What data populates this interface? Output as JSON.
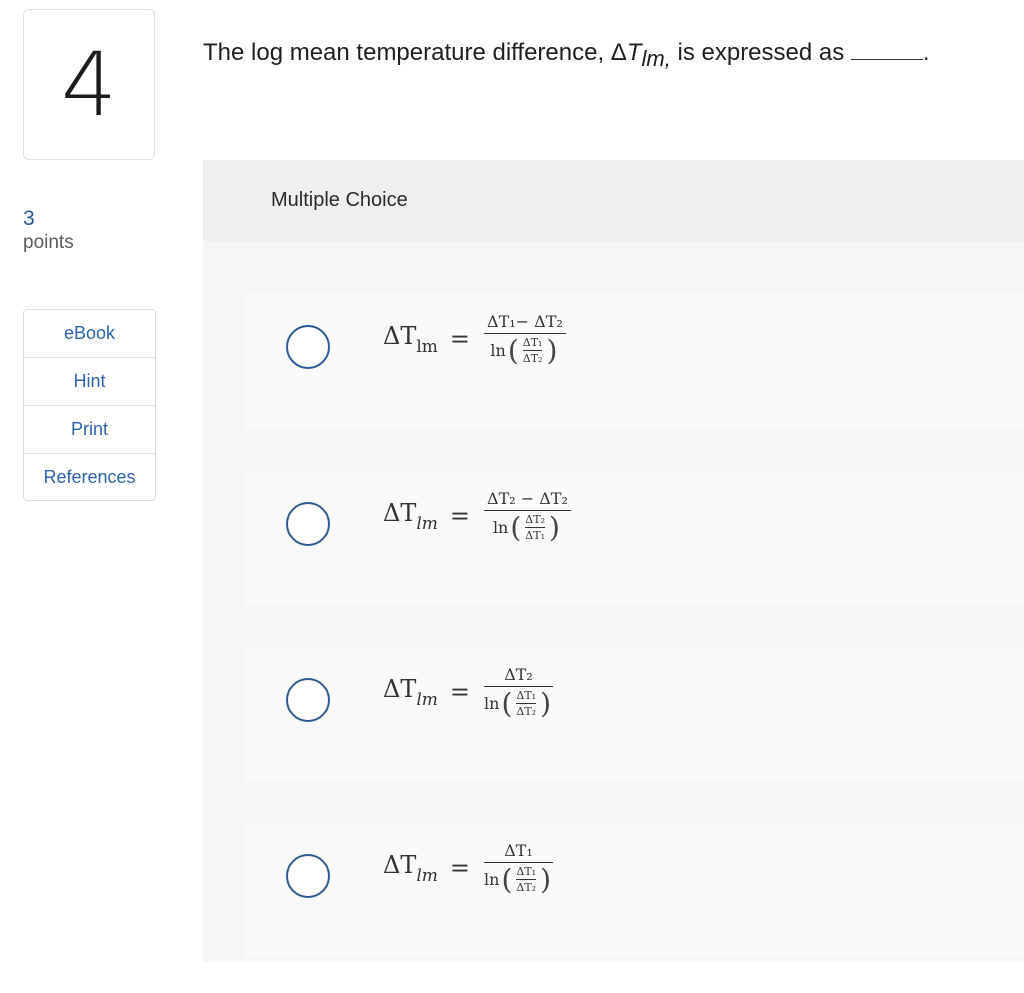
{
  "question_number": "4",
  "points": {
    "value": "3",
    "label": "points"
  },
  "tools": [
    "eBook",
    "Hint",
    "Print",
    "References"
  ],
  "question": {
    "before": "The log mean temperature difference, Δ",
    "var": "T",
    "sub": "lm,",
    "after": " is expressed as ",
    "end": "."
  },
  "section_label": "Multiple Choice",
  "options": [
    {
      "lhs_sub": "lm",
      "numerator": "ΔT₁− ΔT₂",
      "small_num": "ΔT₁",
      "small_den": "ΔT₂"
    },
    {
      "lhs_sub": "lm",
      "numerator": "ΔT₂ − ΔT₂",
      "small_num": "ΔT₂",
      "small_den": "ΔT₁"
    },
    {
      "lhs_sub": "lm",
      "numerator": "ΔT₂",
      "small_num": "ΔT₁",
      "small_den": "ΔT₂"
    },
    {
      "lhs_sub": "lm",
      "numerator": "ΔT₁",
      "small_num": "ΔT₁",
      "small_den": "ΔT₂"
    }
  ],
  "common": {
    "lhs_delta_T": "ΔT",
    "equals": "=",
    "ln": "ln",
    "open_paren": "(",
    "close_paren": ")"
  }
}
